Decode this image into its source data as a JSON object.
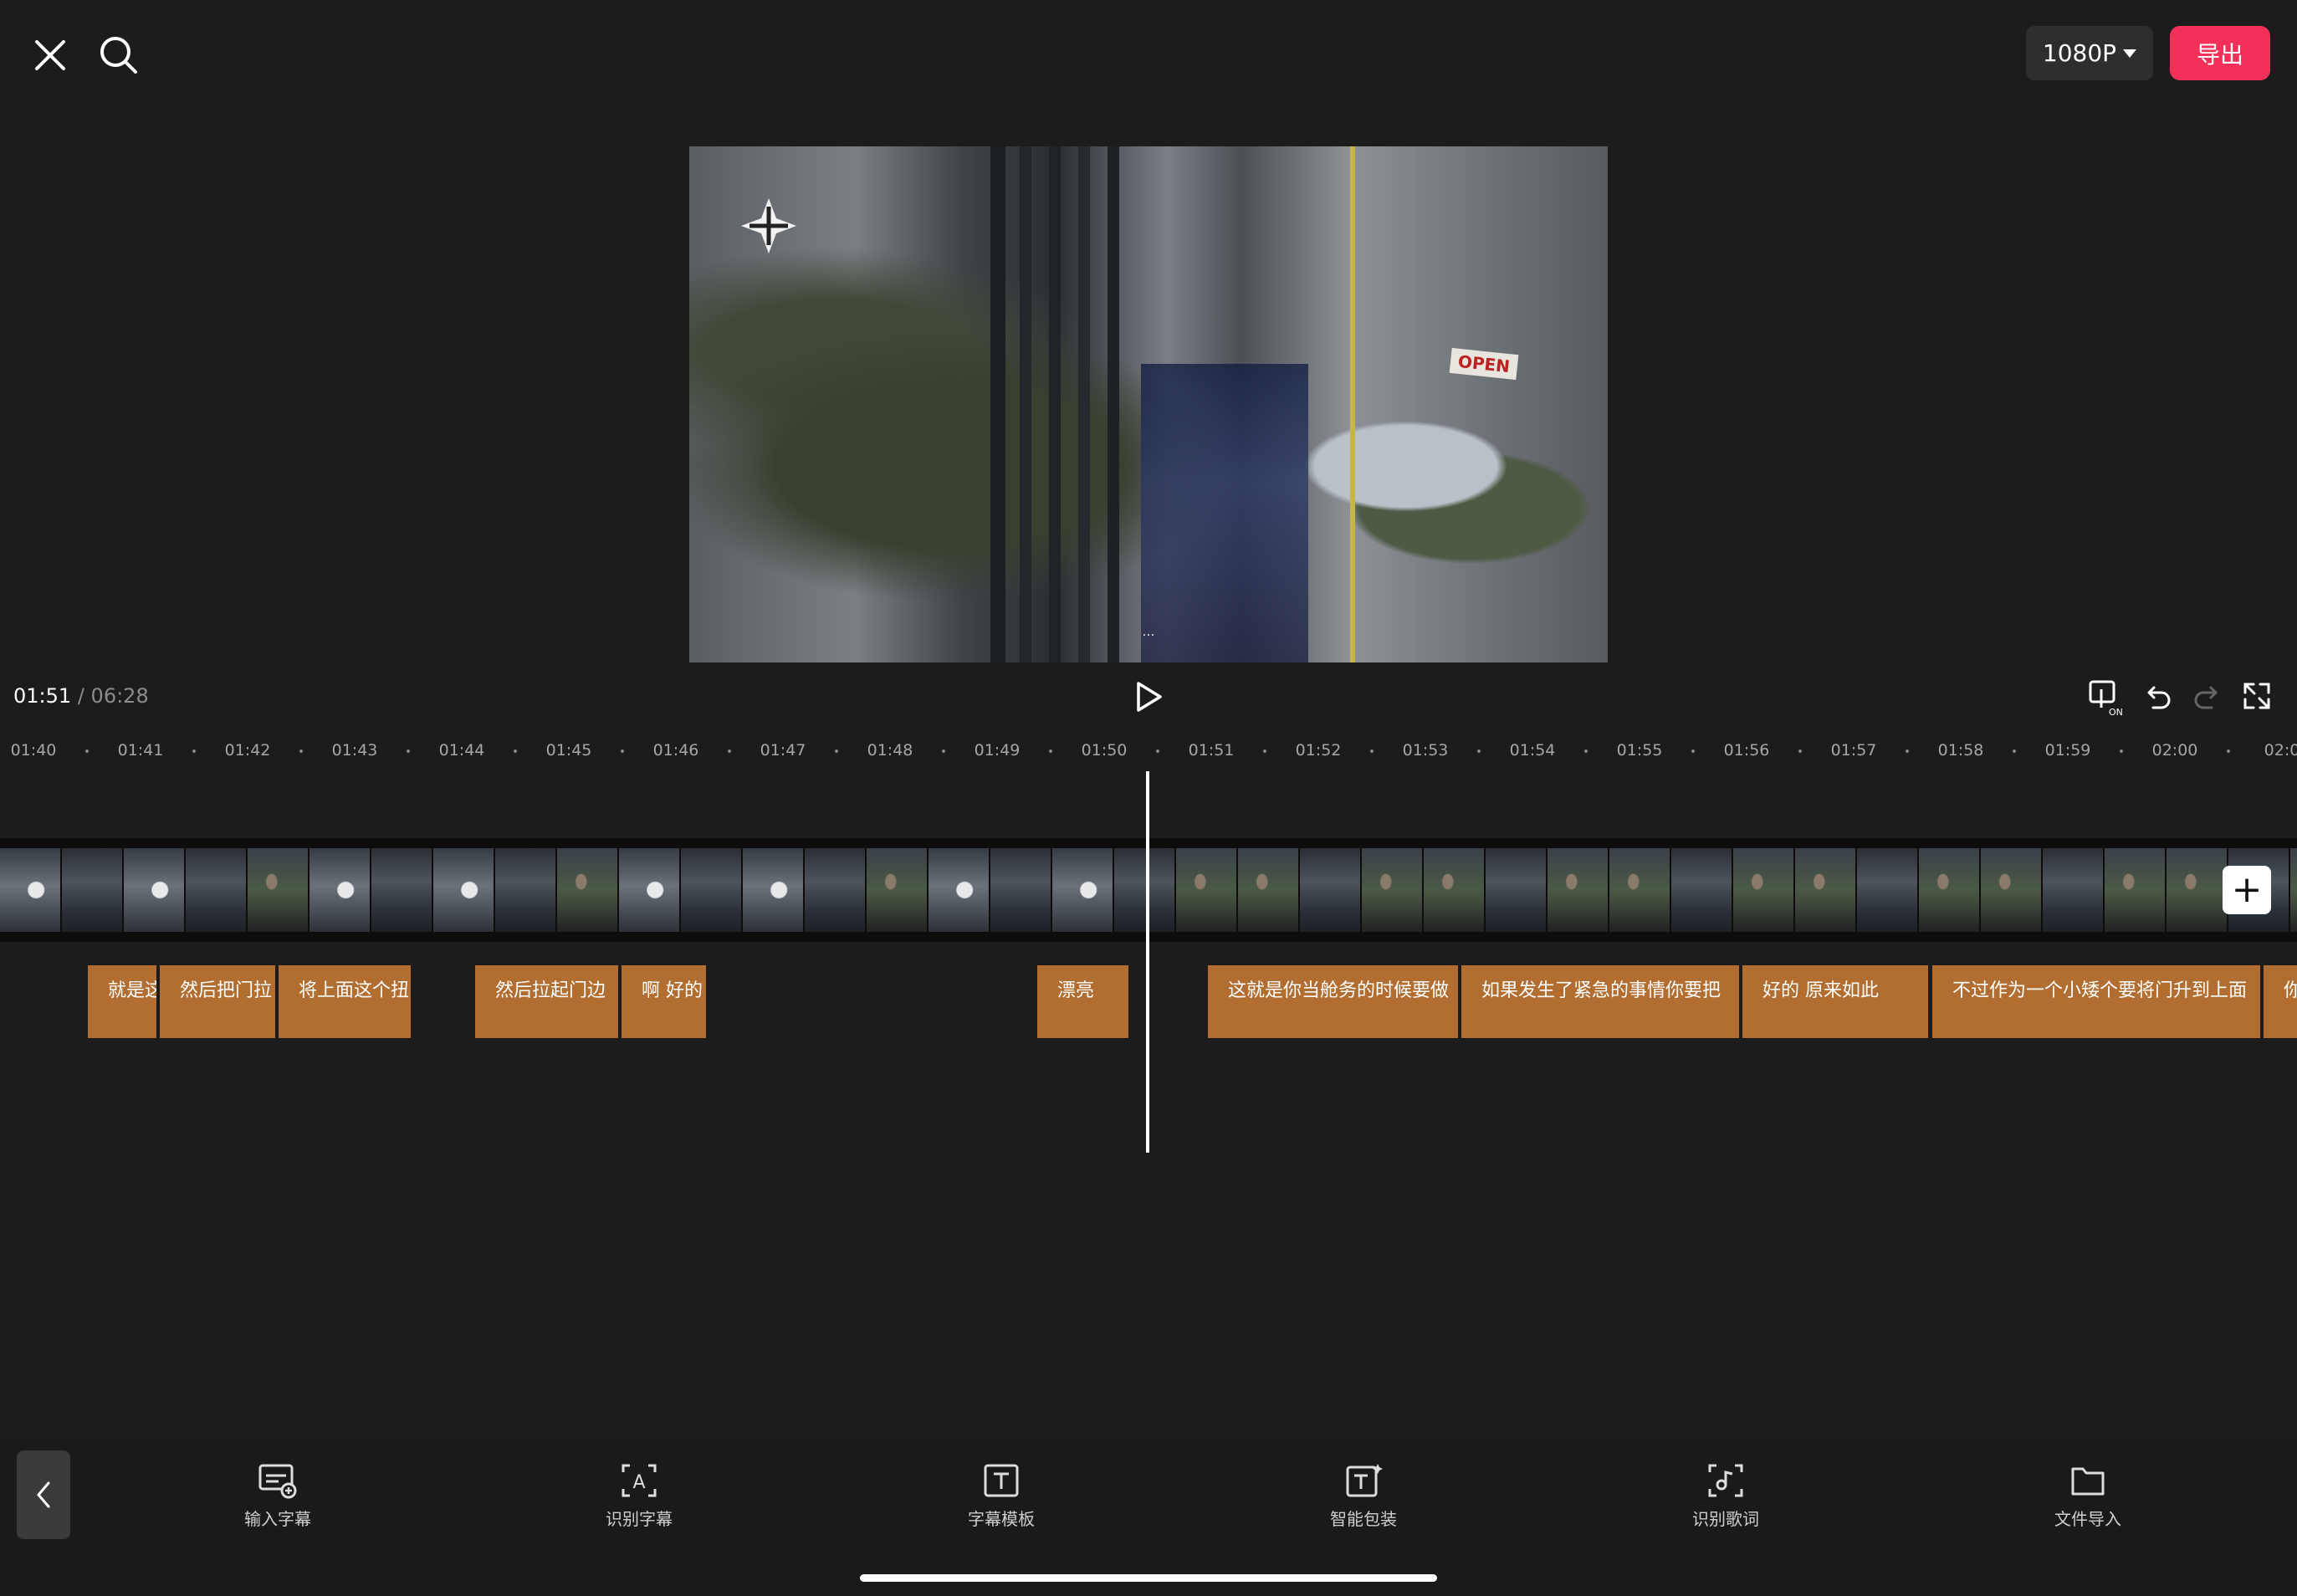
{
  "header": {
    "resolution_label": "1080P",
    "export_label": "导出"
  },
  "preview": {
    "caption": "...",
    "patch_badge": "OPEN"
  },
  "transport": {
    "current_time": "01:51",
    "separator": "/",
    "total_time": "06:28"
  },
  "ruler": {
    "ticks": [
      "01:40",
      "01:41",
      "01:42",
      "01:43",
      "01:44",
      "01:45",
      "01:46",
      "01:47",
      "01:48",
      "01:49",
      "01:50",
      "01:51",
      "01:52",
      "01:53",
      "01:54",
      "01:55",
      "01:56",
      "01:57",
      "01:58",
      "01:59",
      "02:00",
      "02:0"
    ]
  },
  "subtitles": [
    {
      "text": "就是这"
    },
    {
      "text": "然后把门拉"
    },
    {
      "text": "将上面这个扭"
    },
    {
      "text": "然后拉起门边"
    },
    {
      "text": "啊 好的"
    },
    {
      "text": "漂亮"
    },
    {
      "text": "这就是你当舱务的时候要做"
    },
    {
      "text": "如果发生了紧急的事情你要把"
    },
    {
      "text": "好的 原来如此"
    },
    {
      "text": "不过作为一个小矮个要将门升到上面"
    },
    {
      "text": "你"
    }
  ],
  "toolbar": {
    "items": [
      {
        "label": "输入字幕"
      },
      {
        "label": "识别字幕"
      },
      {
        "label": "字幕模板"
      },
      {
        "label": "智能包装"
      },
      {
        "label": "识别歌词"
      },
      {
        "label": "文件导入"
      }
    ]
  },
  "icons": {
    "close": "close-icon",
    "search": "search-icon",
    "play": "play-icon",
    "compare": "compare-on-icon",
    "undo": "undo-icon",
    "redo": "redo-icon",
    "fullscreen": "fullscreen-icon",
    "back": "chevron-left-icon",
    "add": "plus-icon"
  },
  "colors": {
    "export_button": "#f2305a",
    "subtitle_clip": "#b26e31",
    "background": "#1c1c1c"
  }
}
